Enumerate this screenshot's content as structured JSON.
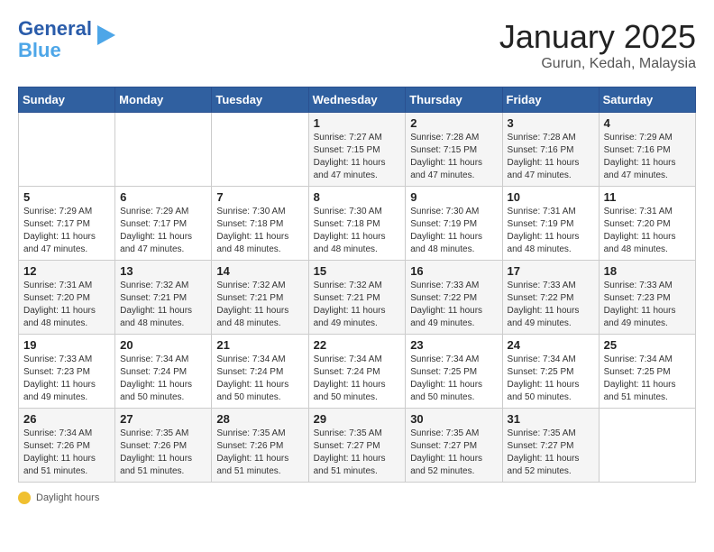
{
  "header": {
    "logo_line1": "General",
    "logo_line2": "Blue",
    "title": "January 2025",
    "subtitle": "Gurun, Kedah, Malaysia"
  },
  "days_of_week": [
    "Sunday",
    "Monday",
    "Tuesday",
    "Wednesday",
    "Thursday",
    "Friday",
    "Saturday"
  ],
  "weeks": [
    [
      {
        "day": "",
        "info": ""
      },
      {
        "day": "",
        "info": ""
      },
      {
        "day": "",
        "info": ""
      },
      {
        "day": "1",
        "info": "Sunrise: 7:27 AM\nSunset: 7:15 PM\nDaylight: 11 hours and 47 minutes."
      },
      {
        "day": "2",
        "info": "Sunrise: 7:28 AM\nSunset: 7:15 PM\nDaylight: 11 hours and 47 minutes."
      },
      {
        "day": "3",
        "info": "Sunrise: 7:28 AM\nSunset: 7:16 PM\nDaylight: 11 hours and 47 minutes."
      },
      {
        "day": "4",
        "info": "Sunrise: 7:29 AM\nSunset: 7:16 PM\nDaylight: 11 hours and 47 minutes."
      }
    ],
    [
      {
        "day": "5",
        "info": "Sunrise: 7:29 AM\nSunset: 7:17 PM\nDaylight: 11 hours and 47 minutes."
      },
      {
        "day": "6",
        "info": "Sunrise: 7:29 AM\nSunset: 7:17 PM\nDaylight: 11 hours and 47 minutes."
      },
      {
        "day": "7",
        "info": "Sunrise: 7:30 AM\nSunset: 7:18 PM\nDaylight: 11 hours and 48 minutes."
      },
      {
        "day": "8",
        "info": "Sunrise: 7:30 AM\nSunset: 7:18 PM\nDaylight: 11 hours and 48 minutes."
      },
      {
        "day": "9",
        "info": "Sunrise: 7:30 AM\nSunset: 7:19 PM\nDaylight: 11 hours and 48 minutes."
      },
      {
        "day": "10",
        "info": "Sunrise: 7:31 AM\nSunset: 7:19 PM\nDaylight: 11 hours and 48 minutes."
      },
      {
        "day": "11",
        "info": "Sunrise: 7:31 AM\nSunset: 7:20 PM\nDaylight: 11 hours and 48 minutes."
      }
    ],
    [
      {
        "day": "12",
        "info": "Sunrise: 7:31 AM\nSunset: 7:20 PM\nDaylight: 11 hours and 48 minutes."
      },
      {
        "day": "13",
        "info": "Sunrise: 7:32 AM\nSunset: 7:21 PM\nDaylight: 11 hours and 48 minutes."
      },
      {
        "day": "14",
        "info": "Sunrise: 7:32 AM\nSunset: 7:21 PM\nDaylight: 11 hours and 48 minutes."
      },
      {
        "day": "15",
        "info": "Sunrise: 7:32 AM\nSunset: 7:21 PM\nDaylight: 11 hours and 49 minutes."
      },
      {
        "day": "16",
        "info": "Sunrise: 7:33 AM\nSunset: 7:22 PM\nDaylight: 11 hours and 49 minutes."
      },
      {
        "day": "17",
        "info": "Sunrise: 7:33 AM\nSunset: 7:22 PM\nDaylight: 11 hours and 49 minutes."
      },
      {
        "day": "18",
        "info": "Sunrise: 7:33 AM\nSunset: 7:23 PM\nDaylight: 11 hours and 49 minutes."
      }
    ],
    [
      {
        "day": "19",
        "info": "Sunrise: 7:33 AM\nSunset: 7:23 PM\nDaylight: 11 hours and 49 minutes."
      },
      {
        "day": "20",
        "info": "Sunrise: 7:34 AM\nSunset: 7:24 PM\nDaylight: 11 hours and 50 minutes."
      },
      {
        "day": "21",
        "info": "Sunrise: 7:34 AM\nSunset: 7:24 PM\nDaylight: 11 hours and 50 minutes."
      },
      {
        "day": "22",
        "info": "Sunrise: 7:34 AM\nSunset: 7:24 PM\nDaylight: 11 hours and 50 minutes."
      },
      {
        "day": "23",
        "info": "Sunrise: 7:34 AM\nSunset: 7:25 PM\nDaylight: 11 hours and 50 minutes."
      },
      {
        "day": "24",
        "info": "Sunrise: 7:34 AM\nSunset: 7:25 PM\nDaylight: 11 hours and 50 minutes."
      },
      {
        "day": "25",
        "info": "Sunrise: 7:34 AM\nSunset: 7:25 PM\nDaylight: 11 hours and 51 minutes."
      }
    ],
    [
      {
        "day": "26",
        "info": "Sunrise: 7:34 AM\nSunset: 7:26 PM\nDaylight: 11 hours and 51 minutes."
      },
      {
        "day": "27",
        "info": "Sunrise: 7:35 AM\nSunset: 7:26 PM\nDaylight: 11 hours and 51 minutes."
      },
      {
        "day": "28",
        "info": "Sunrise: 7:35 AM\nSunset: 7:26 PM\nDaylight: 11 hours and 51 minutes."
      },
      {
        "day": "29",
        "info": "Sunrise: 7:35 AM\nSunset: 7:27 PM\nDaylight: 11 hours and 51 minutes."
      },
      {
        "day": "30",
        "info": "Sunrise: 7:35 AM\nSunset: 7:27 PM\nDaylight: 11 hours and 52 minutes."
      },
      {
        "day": "31",
        "info": "Sunrise: 7:35 AM\nSunset: 7:27 PM\nDaylight: 11 hours and 52 minutes."
      },
      {
        "day": "",
        "info": ""
      }
    ]
  ],
  "footer": {
    "daylight_label": "Daylight hours"
  }
}
